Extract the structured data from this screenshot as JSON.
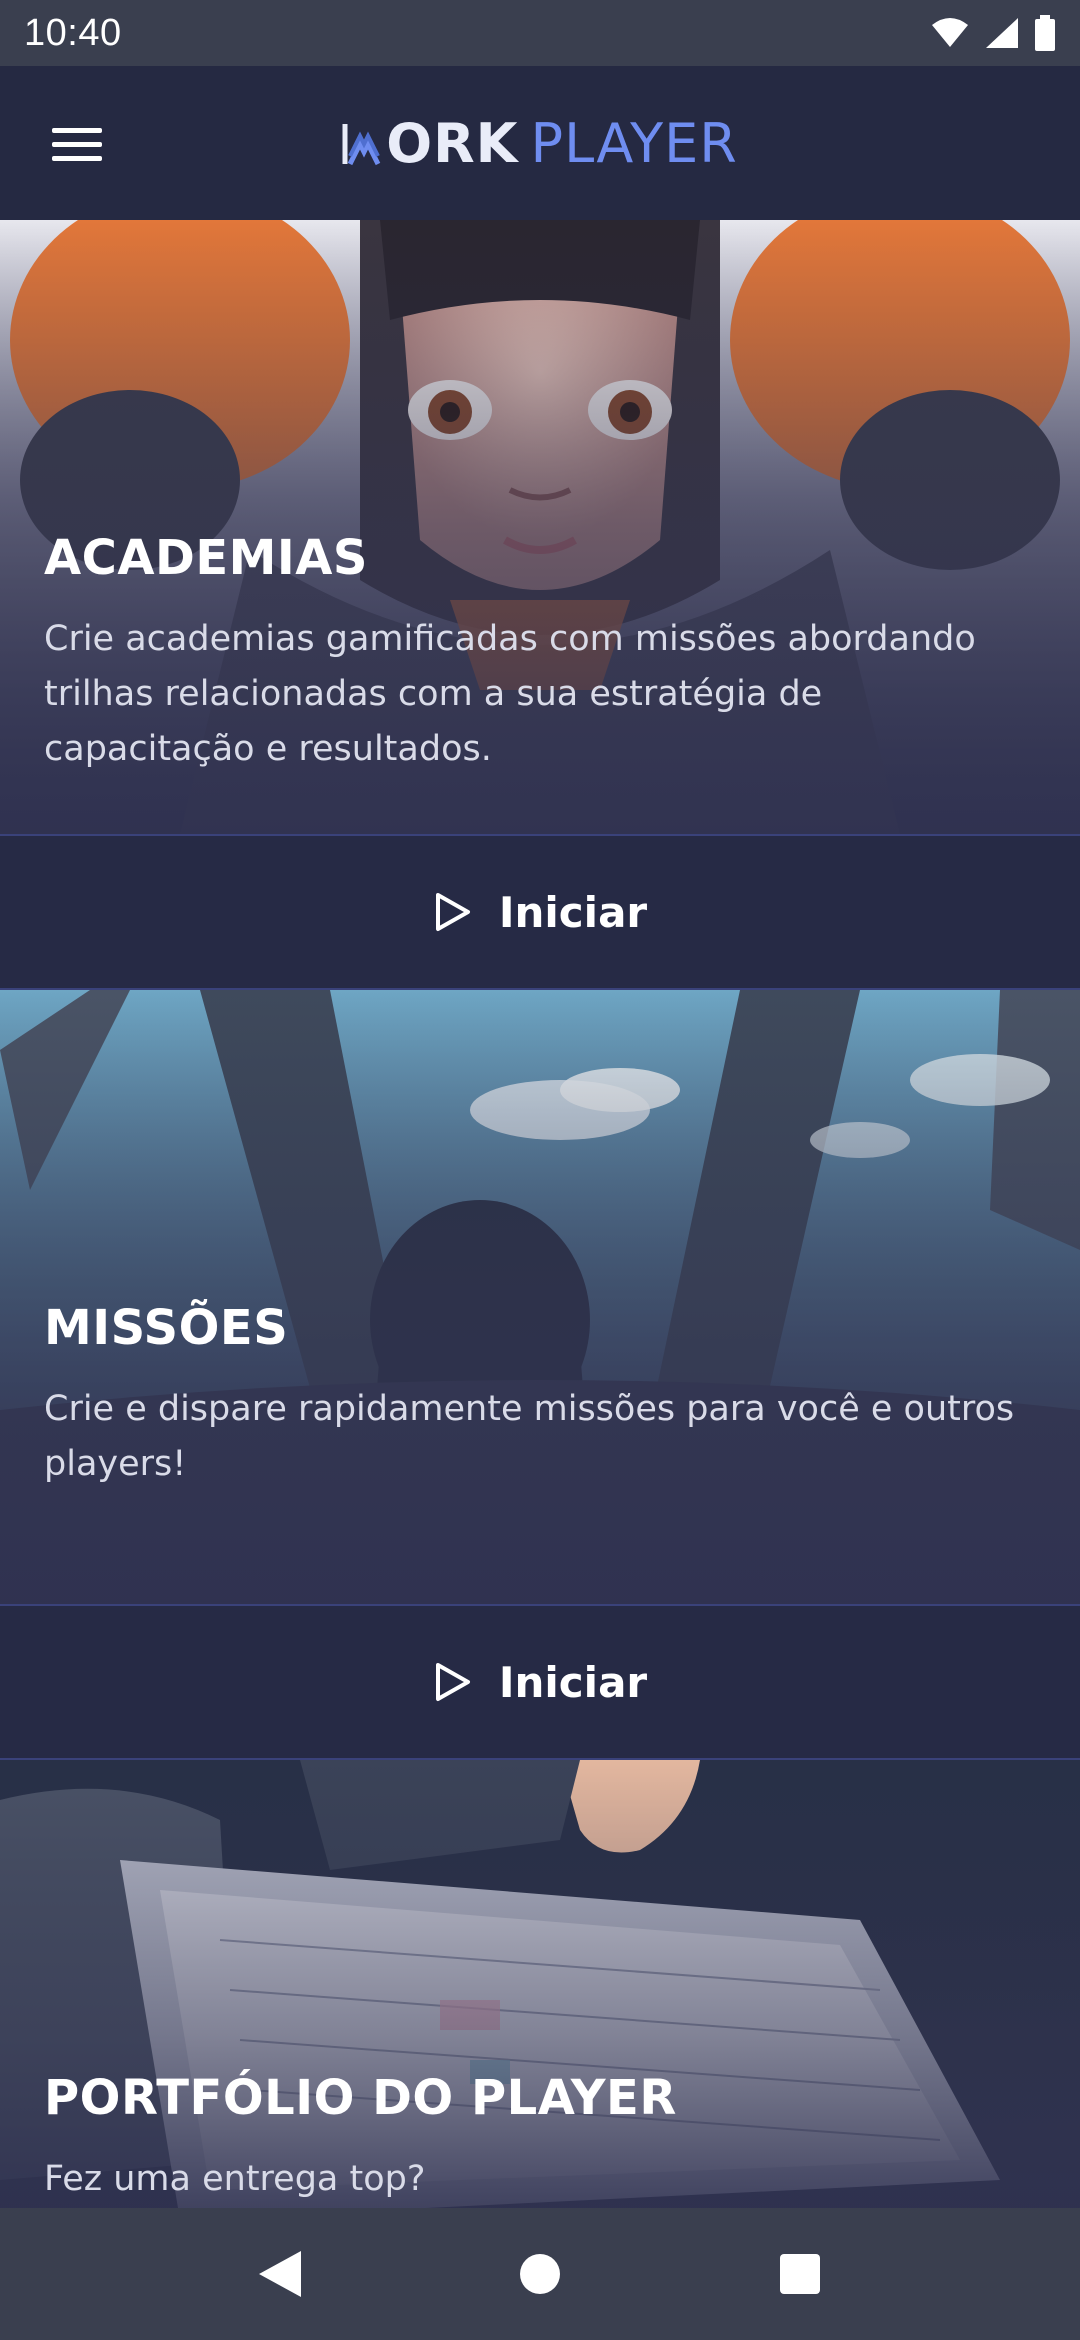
{
  "status_bar": {
    "time": "10:40",
    "icons": [
      "wifi-icon",
      "signal-icon",
      "battery-icon"
    ]
  },
  "app_bar": {
    "menu_icon": "hamburger-menu-icon",
    "brand": {
      "word1": "ORK",
      "word2": "PLAYER"
    }
  },
  "cards": [
    {
      "title": "ACADEMIAS",
      "description": "Crie academias gamificadas com missões abordando trilhas relacionadas com a sua estratégia de capacitação e resultados.",
      "button_label": "Iniciar",
      "button_icon": "play-outline-icon"
    },
    {
      "title": "MISSÕES",
      "description": "Crie e dispare rapidamente missões para você e outros players!",
      "button_label": "Iniciar",
      "button_icon": "play-outline-icon"
    },
    {
      "title": "PORTFÓLIO DO PLAYER",
      "description": "Fez uma entrega top?"
    }
  ],
  "nav_bar": {
    "icons": [
      "back-icon",
      "home-icon",
      "recents-icon"
    ]
  },
  "colors": {
    "background": "#272a45",
    "app_bar": "#252942",
    "accent": "#6f8df0",
    "system_bars": "#3a3f4f"
  }
}
